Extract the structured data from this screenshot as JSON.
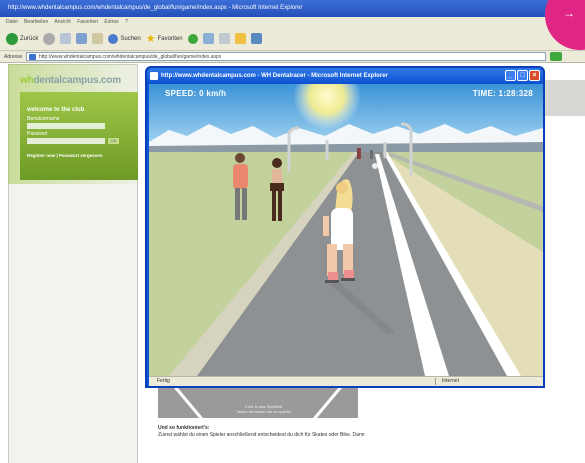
{
  "outer_window": {
    "title": "http://www.whdentalcampus.com/whdentalcampus/de_global/fun/game/index.aspx - Microsoft Internet Explorer",
    "menu": [
      "Datei",
      "Bearbeiten",
      "Ansicht",
      "Favoriten",
      "Extras",
      "?"
    ],
    "toolbar": {
      "back_label": "Zurück",
      "search_label": "Suchen",
      "favorites_label": "Favoriten"
    },
    "address_label": "Adresse",
    "address_value": "http://www.whdentalcampus.com/whdentalcampus/de_global/fun/game/index.aspx"
  },
  "site": {
    "logo_prefix": "wh",
    "logo_rest": "dentalcampus.com",
    "welcome": "welcome to the club",
    "username_label": "Benutzername",
    "password_label": "Passwort",
    "ok_label": "OK",
    "links": "Register now  |  Passwort vergessen",
    "thumb_caption": "Klick in das Spielfeld\nTasten benutzen um zu spielen",
    "bottom_heading": "Und so funktioniert's:",
    "bottom_body": "Zuerst wählst du einen Spieler anschließend entscheidest du dich für Skates oder Bike. Dann"
  },
  "popup": {
    "title": "http://www.whdentalcampus.com - WH Dentalracer - Microsoft Internet Explorer",
    "status_left": "Fertig",
    "status_zone": "Internet"
  },
  "game": {
    "speed_text": "SPEED: 0 km/h",
    "time_text": "TIME: 1:28:328",
    "speed_kmh": 0
  },
  "colors": {
    "ie_blue": "#0a55d9",
    "brand_green": "#9ec648",
    "magenta": "#e02684"
  }
}
